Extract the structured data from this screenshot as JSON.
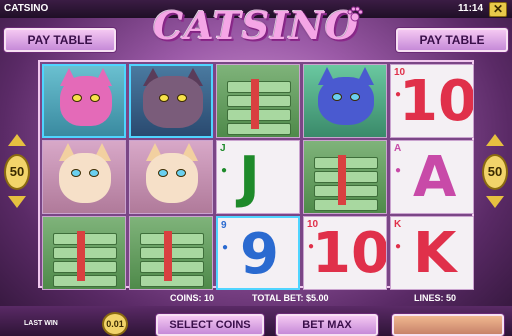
{
  "window": {
    "name": "CATSINO",
    "clock": "11:14",
    "close_symbol": "✕"
  },
  "logo": {
    "text": "CATSINO"
  },
  "buttons": {
    "pay_table_left": "PAY TABLE",
    "pay_table_right": "PAY TABLE",
    "select_coins": "SELECT COINS",
    "bet_max": "BET MAX"
  },
  "lines_indicator": {
    "left_value": "50",
    "right_value": "50"
  },
  "reels": [
    [
      "pink-cat",
      "blonde-cat",
      "cash-stack"
    ],
    [
      "grey-cat",
      "blonde-cat",
      "cash-stack"
    ],
    [
      "cash-stack",
      "J",
      "9"
    ],
    [
      "blue-cat",
      "cash-stack",
      "10"
    ],
    [
      "10",
      "A",
      "K"
    ]
  ],
  "card_colors": {
    "10": "#e0304a",
    "A": "#c84aa8",
    "K": "#e0304a",
    "J": "#1e8a2a",
    "9": "#2a6ad0"
  },
  "info": {
    "coins": "COINS: 10",
    "total_bet": "TOTAL BET: $5.00",
    "lines": "LINES: 50"
  },
  "bottom": {
    "last_win_label": "LAST WIN",
    "coin_value": "0.01"
  }
}
